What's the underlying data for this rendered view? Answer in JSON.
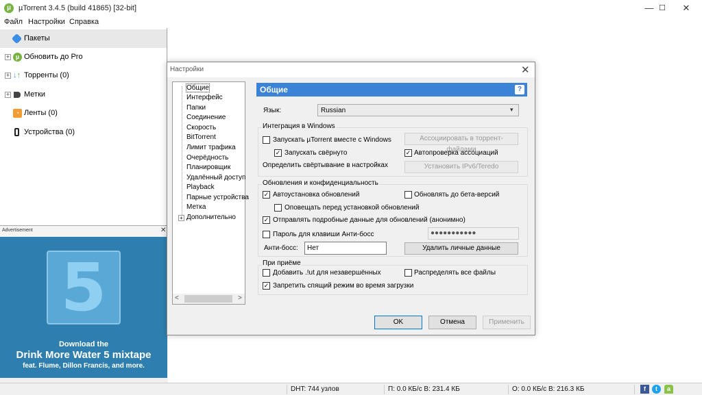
{
  "window": {
    "title": "µTorrent 3.4.5  (build 41865) [32-bit]",
    "minimize": "—",
    "maximize": "☐",
    "close": "✕"
  },
  "menu": [
    "Файл",
    "Настройки",
    "Справка"
  ],
  "sidebar": {
    "items": [
      {
        "label": "Пакеты",
        "icon": "bundle-icon"
      },
      {
        "label": "Обновить до Pro",
        "icon": "utorrent-icon"
      },
      {
        "label": "Торренты (0)",
        "icon": "torrents-icon"
      },
      {
        "label": "Метки",
        "icon": "label-icon"
      },
      {
        "label": "Ленты (0)",
        "icon": "rss-icon"
      },
      {
        "label": "Устройства (0)",
        "icon": "device-icon"
      }
    ]
  },
  "ad": {
    "label": "Advertisement",
    "close": "✕",
    "big_number": "5",
    "line1": "Download the",
    "line2": "Drink More Water 5 mixtape",
    "line3": "feat. Flume, Dillon Francis, and more."
  },
  "statusbar": {
    "dht": "DHT: 744 узлов",
    "download": "П: 0.0 КБ/с В: 231.4 КБ",
    "upload": "О: 0.0 КБ/с В: 216.3 КБ"
  },
  "dialog": {
    "title": "Настройки",
    "close": "✕",
    "tree": [
      "Общие",
      "Интерфейс",
      "Папки",
      "Соединение",
      "Скорость",
      "BitTorrent",
      "Лимит трафика",
      "Очерёдность",
      "Планировщик",
      "Удалённый доступ",
      "Playback",
      "Парные устройства",
      "Метка",
      "Дополнительно"
    ],
    "tree_scroll_left": "<",
    "tree_scroll_right": ">",
    "section_title": "Общие",
    "help": "?",
    "language_label": "Язык:",
    "language_value": "Russian",
    "integration": {
      "title": "Интеграция в Windows",
      "start_with_windows": "Запускать µTorrent вместе с Windows",
      "start_minimized": "Запускать свёрнуто",
      "minimize_settings": "Определить свёртывание в настройках",
      "associate_button": "Ассоциировать в торрент-файлами",
      "auto_check": "Автопроверка ассоциаций",
      "ipv6_button": "Установить IPv6/Teredo"
    },
    "updates": {
      "title": "Обновления и конфиденциальность",
      "auto_install": "Автоустановка обновлений",
      "beta": "Обновлять до бета-версий",
      "notify": "Оповещать перед установкой обновлений",
      "send_data": "Отправлять подробные данные для обновлений (анонимно)",
      "boss_password": "Пароль для клавиши Анти-босс",
      "password_value": "●●●●●●●●●●●",
      "boss_label": "Анти-босс:",
      "boss_value": "Нет",
      "clear_button": "Удалить личные данные"
    },
    "receive": {
      "title": "При приёме",
      "add_ut": "Добавить .!ut для незавершённых",
      "allocate": "Распределять все файлы",
      "prevent_sleep": "Запретить спящий режим во время загрузки"
    },
    "buttons": {
      "ok": "OK",
      "cancel": "Отмена",
      "apply": "Применить"
    }
  }
}
